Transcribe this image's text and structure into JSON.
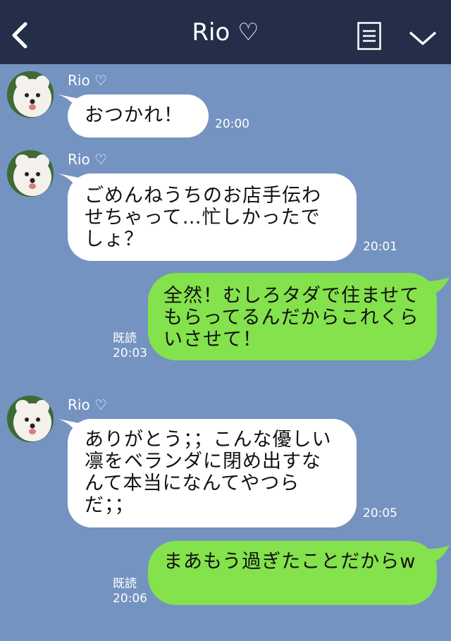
{
  "header": {
    "title": "Rio ♡",
    "back_icon": "chevron-left-icon",
    "menu_icon": "list-icon",
    "collapse_icon": "chevron-down-icon",
    "bg_color": "#242e48"
  },
  "chat": {
    "bg_color": "#7493c1",
    "incoming_bubble_color": "#ffffff",
    "outgoing_bubble_color": "#84e24c",
    "messages": [
      {
        "direction": "in",
        "sender": "Rio ♡",
        "text": "おつかれ！",
        "time": "20:00"
      },
      {
        "direction": "in",
        "sender": "Rio ♡",
        "text": "ごめんねうちのお店手伝わせちゃって…忙しかったでしょ？",
        "time": "20:01"
      },
      {
        "direction": "out",
        "text": "全然！むしろタダで住ませてもらってるんだからこれくらいさせて！",
        "read": "既読",
        "time": "20:03"
      },
      {
        "direction": "in",
        "sender": "Rio ♡",
        "text": "ありがとう；；こんな優しい凛をベランダに閉め出すなんて本当になんてやつらだ；；",
        "time": "20:05"
      },
      {
        "direction": "out",
        "text": "まあもう過ぎたことだからw",
        "read": "既読",
        "time": "20:06"
      }
    ]
  }
}
